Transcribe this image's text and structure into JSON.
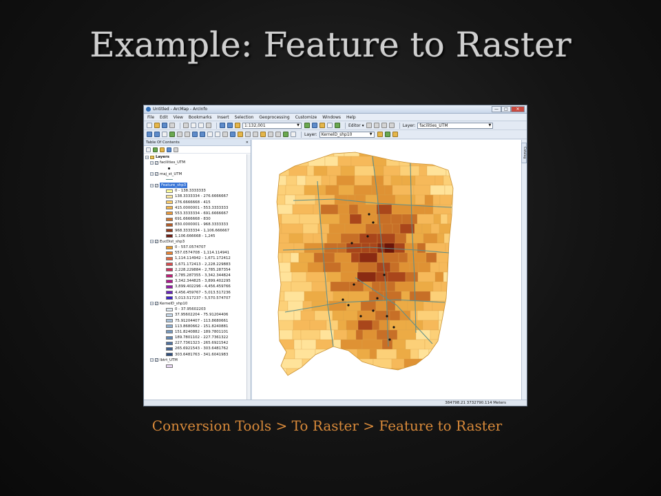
{
  "slide": {
    "title": "Example: Feature to Raster",
    "caption": "Conversion Tools > To Raster > Feature to Raster"
  },
  "window": {
    "title": "Untitled - ArcMap - ArcInfo",
    "buttons": {
      "min": "—",
      "max": "□",
      "close": "✕"
    }
  },
  "menu": [
    "File",
    "Edit",
    "View",
    "Bookmarks",
    "Insert",
    "Selection",
    "Geoprocessing",
    "Customize",
    "Windows",
    "Help"
  ],
  "toolbar": {
    "scale": "1:132,001",
    "editor_label": "Editor ▾",
    "layer_label": "Layer:",
    "layer_value": "facilities_UTM",
    "layer2_label": "Layer:",
    "layer2_value": "KernelD_shp10"
  },
  "toc": {
    "title": "Table Of Contents",
    "close": "✕",
    "layers_root": "Layers",
    "layers": [
      {
        "name": "facilities_UTM",
        "symbol": "point"
      },
      {
        "name": "maj_st_UTM",
        "symbol": "line"
      },
      {
        "name": "Feature_shp3",
        "selected": true,
        "classes": [
          {
            "label": "0 - 138.3333333",
            "color": "#ffff99"
          },
          {
            "label": "138.3333334 - 276.6666667",
            "color": "#fde79a"
          },
          {
            "label": "276.6666668 - 415",
            "color": "#f9cb6a"
          },
          {
            "label": "415.0000001 - 553.3333333",
            "color": "#f2b34a"
          },
          {
            "label": "553.3333334 - 691.6666667",
            "color": "#e6983c"
          },
          {
            "label": "691.6666668 - 830",
            "color": "#cf7630"
          },
          {
            "label": "830.0000001 - 968.3333333",
            "color": "#b35a25"
          },
          {
            "label": "968.3333334 - 1,106.666667",
            "color": "#92391a"
          },
          {
            "label": "1,106.666668 - 1,245",
            "color": "#6e1a10"
          }
        ]
      },
      {
        "name": "EucDist_shp3",
        "classes": [
          {
            "label": "0 - 557.0574707",
            "color": "#e69b2e"
          },
          {
            "label": "557.0574708 - 1,114.114941",
            "color": "#e58133"
          },
          {
            "label": "1,114.114942 - 1,671.172412",
            "color": "#e0663e"
          },
          {
            "label": "1,671.172413 - 2,228.229883",
            "color": "#d64b4d"
          },
          {
            "label": "2,228.229884 - 2,785.287354",
            "color": "#cc305e"
          },
          {
            "label": "2,785.287355 - 3,342.344824",
            "color": "#c01a76"
          },
          {
            "label": "3,342.344825 - 3,899.402295",
            "color": "#b0148e"
          },
          {
            "label": "3,899.402296 - 4,456.459766",
            "color": "#931aa6"
          },
          {
            "label": "4,456.459767 - 5,013.517236",
            "color": "#6a22bc"
          },
          {
            "label": "5,013.517237 - 5,570.574707",
            "color": "#3b20c9"
          }
        ]
      },
      {
        "name": "KernelD_shp10",
        "classes": [
          {
            "label": "0 - 37.95602203",
            "color": "#dfe9f2"
          },
          {
            "label": "37.95602204 - 75.91204406",
            "color": "#c3d5e6"
          },
          {
            "label": "75.91204407 - 113.8680661",
            "color": "#a8c1da"
          },
          {
            "label": "113.8680662 - 151.8240881",
            "color": "#8eadcd"
          },
          {
            "label": "151.8240882 - 189.7801101",
            "color": "#7699bf"
          },
          {
            "label": "189.7801102 - 227.7361322",
            "color": "#6285b0"
          },
          {
            "label": "227.7361323 - 265.6921542",
            "color": "#4f72a0"
          },
          {
            "label": "265.6921543 - 303.6481762",
            "color": "#3f608f"
          },
          {
            "label": "303.6481763 - 341.6041983",
            "color": "#2f4e7d"
          }
        ]
      },
      {
        "name": "lbtrt_UTM",
        "symbol": "polygon",
        "color": "#e7d6f2"
      }
    ]
  },
  "status": {
    "coords": "384798.21  3732790.114 Meters"
  },
  "map": {
    "palette": [
      "#ffe39a",
      "#fcd078",
      "#f6b95a",
      "#ecab45",
      "#df9234",
      "#c76f27",
      "#a9461b",
      "#8a2a12",
      "#6b1509"
    ],
    "road_color": "#5f8f8a",
    "catalog_tab": "Catalog"
  }
}
